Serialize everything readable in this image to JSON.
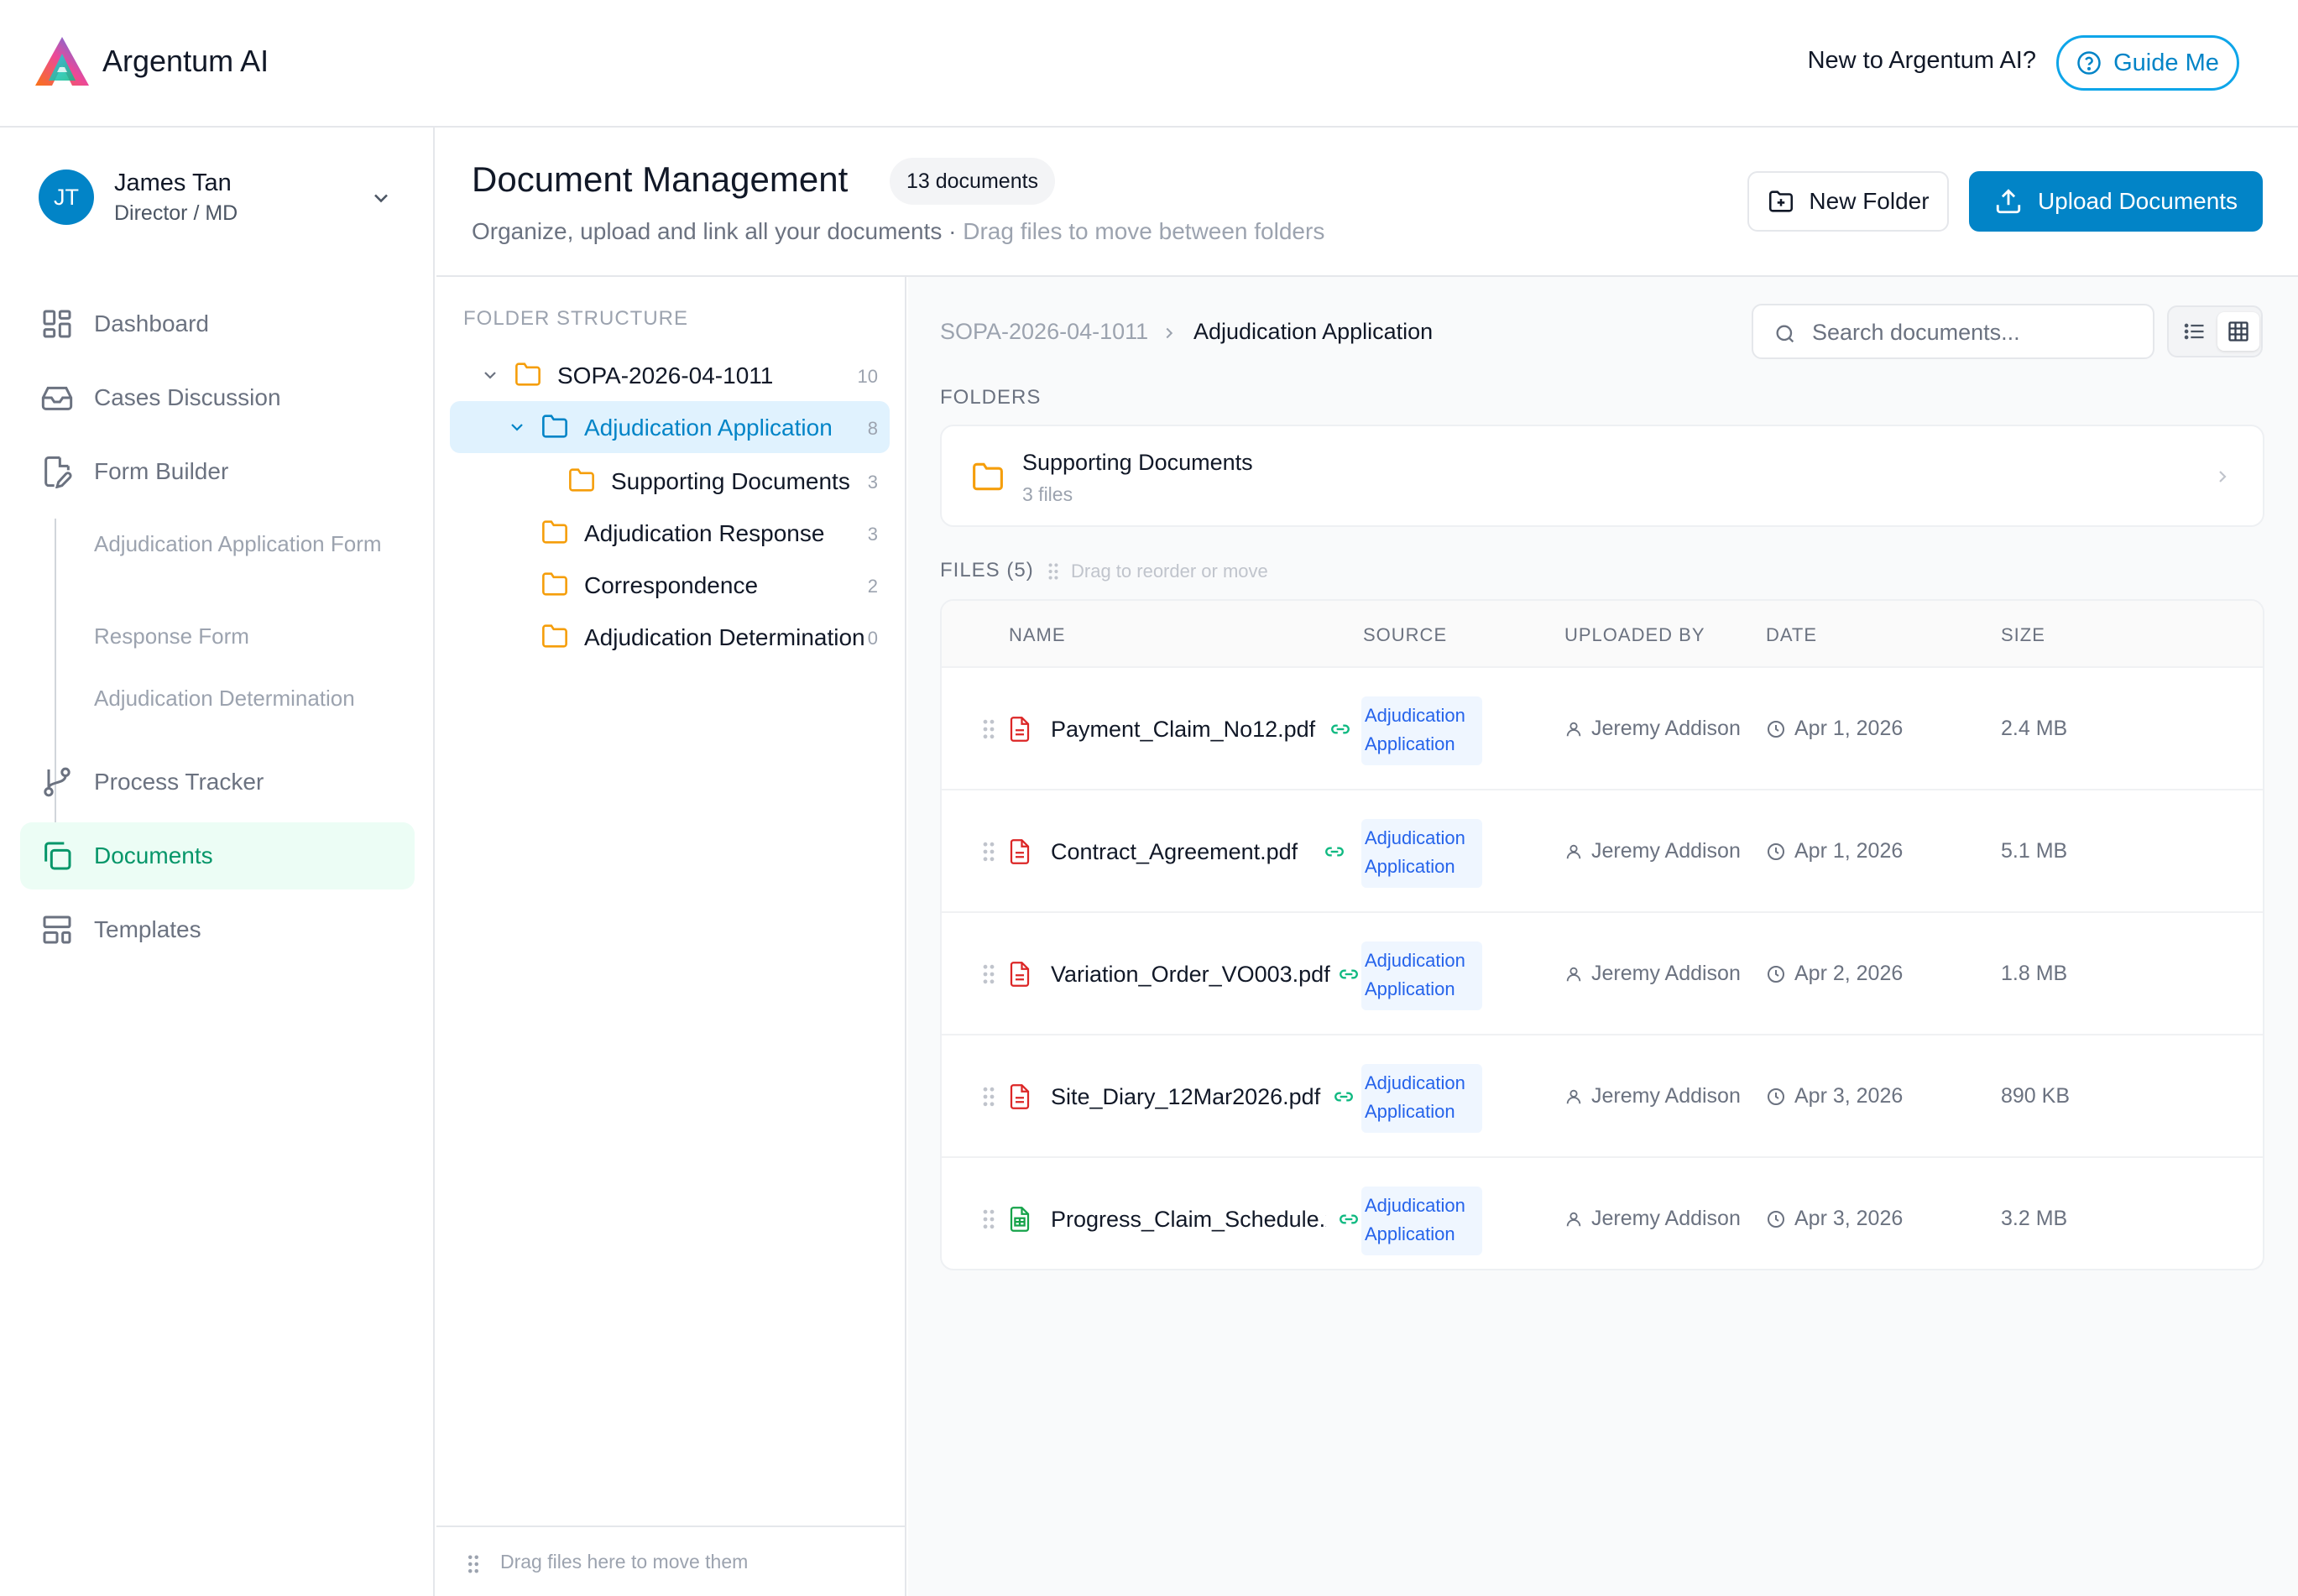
{
  "topbar": {
    "brand": "Argentum AI",
    "new_to": "New to Argentum AI?",
    "guide_label": "Guide Me"
  },
  "user": {
    "initials": "JT",
    "name": "James Tan",
    "role": "Director / MD"
  },
  "nav": {
    "items": [
      {
        "label": "Dashboard",
        "icon": "dashboard-grid-icon"
      },
      {
        "label": "Cases Discussion",
        "icon": "inbox-icon"
      },
      {
        "label": "Form Builder",
        "icon": "file-edit-icon"
      },
      {
        "label": "Process Tracker",
        "icon": "git-branch-icon"
      },
      {
        "label": "Documents",
        "icon": "copy-documents-icon",
        "active": true
      },
      {
        "label": "Templates",
        "icon": "layout-template-icon"
      }
    ],
    "form_builder_sub": [
      "Adjudication Application Form",
      "Response Form",
      "Adjudication Determination"
    ]
  },
  "header": {
    "title": "Document Management",
    "doc_count": "13 documents",
    "subtitle": "Organize, upload and link all your documents · ",
    "subtitle_hint": "Drag files to move between folders",
    "new_folder_label": "New Folder",
    "upload_label": "Upload Documents"
  },
  "tree": {
    "heading": "FOLDER STRUCTURE",
    "rows": [
      {
        "label": "SOPA-2026-04-1011",
        "count": "10",
        "level": 0,
        "expanded": true
      },
      {
        "label": "Adjudication Application",
        "count": "8",
        "level": 1,
        "expanded": true,
        "selected": true
      },
      {
        "label": "Supporting Documents",
        "count": "3",
        "level": 2
      },
      {
        "label": "Adjudication Response",
        "count": "3",
        "level": 1
      },
      {
        "label": "Correspondence",
        "count": "2",
        "level": 1
      },
      {
        "label": "Adjudication Determination",
        "count": "0",
        "level": 1
      }
    ],
    "footer_hint": "Drag files here to move them"
  },
  "breadcrumb": {
    "root": "SOPA-2026-04-1011",
    "current": "Adjudication Application"
  },
  "search": {
    "placeholder": "Search documents...",
    "value": ""
  },
  "folders_section": {
    "label": "FOLDERS",
    "items": [
      {
        "name": "Supporting Documents",
        "sub": "3 files"
      }
    ]
  },
  "files_section": {
    "label": "FILES (5)",
    "hint": "Drag to reorder or move",
    "columns": [
      "NAME",
      "SOURCE",
      "UPLOADED BY",
      "DATE",
      "SIZE"
    ],
    "rows": [
      {
        "name": "Payment_Claim_No12.pdf",
        "type": "pdf",
        "source_line1": "Adjudication",
        "source_line2": "Application",
        "uploaded_by": "Jeremy Addison",
        "date": "Apr 1, 2026",
        "size": "2.4 MB"
      },
      {
        "name": "Contract_Agreement.pdf",
        "type": "pdf",
        "source_line1": "Adjudication",
        "source_line2": "Application",
        "uploaded_by": "Jeremy Addison",
        "date": "Apr 1, 2026",
        "size": "5.1 MB"
      },
      {
        "name": "Variation_Order_VO003.pdf",
        "type": "pdf",
        "source_line1": "Adjudication",
        "source_line2": "Application",
        "uploaded_by": "Jeremy Addison",
        "date": "Apr 2, 2026",
        "size": "1.8 MB"
      },
      {
        "name": "Site_Diary_12Mar2026.pdf",
        "type": "pdf",
        "source_line1": "Adjudication",
        "source_line2": "Application",
        "uploaded_by": "Jeremy Addison",
        "date": "Apr 3, 2026",
        "size": "890 KB"
      },
      {
        "name": "Progress_Claim_Schedule.xlsx",
        "type": "sheet",
        "source_line1": "Adjudication",
        "source_line2": "Application",
        "uploaded_by": "Jeremy Addison",
        "date": "Apr 3, 2026",
        "size": "3.2 MB"
      }
    ]
  },
  "colors": {
    "primary": "#0284c7",
    "active_nav_bg": "#ecfdf5",
    "active_nav_text": "#059669",
    "folder": "#f59e0b",
    "pdf": "#dc2626",
    "sheet": "#16a34a",
    "link": "#10b981"
  }
}
